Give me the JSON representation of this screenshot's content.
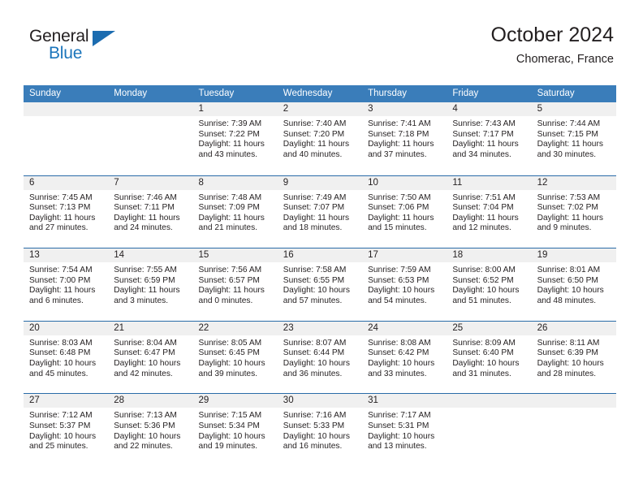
{
  "logo": {
    "word_top": "General",
    "word_bottom": "Blue",
    "triangle_icon": "triangle-icon"
  },
  "header": {
    "title": "October 2024",
    "subtitle": "Chomerac, France"
  },
  "colors": {
    "header_blue": "#3a7dba",
    "rule_blue": "#2a6ca8",
    "daynum_band": "#f0f0f0",
    "logo_blue": "#1b75bb",
    "text": "#231f20"
  },
  "weekdays": [
    "Sunday",
    "Monday",
    "Tuesday",
    "Wednesday",
    "Thursday",
    "Friday",
    "Saturday"
  ],
  "weeks": [
    [
      {
        "day": "",
        "sunrise": "",
        "sunset": "",
        "daylight1": "",
        "daylight2": "",
        "blank": true
      },
      {
        "day": "",
        "sunrise": "",
        "sunset": "",
        "daylight1": "",
        "daylight2": "",
        "blank": true
      },
      {
        "day": "1",
        "sunrise": "Sunrise: 7:39 AM",
        "sunset": "Sunset: 7:22 PM",
        "daylight1": "Daylight: 11 hours",
        "daylight2": "and 43 minutes."
      },
      {
        "day": "2",
        "sunrise": "Sunrise: 7:40 AM",
        "sunset": "Sunset: 7:20 PM",
        "daylight1": "Daylight: 11 hours",
        "daylight2": "and 40 minutes."
      },
      {
        "day": "3",
        "sunrise": "Sunrise: 7:41 AM",
        "sunset": "Sunset: 7:18 PM",
        "daylight1": "Daylight: 11 hours",
        "daylight2": "and 37 minutes."
      },
      {
        "day": "4",
        "sunrise": "Sunrise: 7:43 AM",
        "sunset": "Sunset: 7:17 PM",
        "daylight1": "Daylight: 11 hours",
        "daylight2": "and 34 minutes."
      },
      {
        "day": "5",
        "sunrise": "Sunrise: 7:44 AM",
        "sunset": "Sunset: 7:15 PM",
        "daylight1": "Daylight: 11 hours",
        "daylight2": "and 30 minutes."
      }
    ],
    [
      {
        "day": "6",
        "sunrise": "Sunrise: 7:45 AM",
        "sunset": "Sunset: 7:13 PM",
        "daylight1": "Daylight: 11 hours",
        "daylight2": "and 27 minutes."
      },
      {
        "day": "7",
        "sunrise": "Sunrise: 7:46 AM",
        "sunset": "Sunset: 7:11 PM",
        "daylight1": "Daylight: 11 hours",
        "daylight2": "and 24 minutes."
      },
      {
        "day": "8",
        "sunrise": "Sunrise: 7:48 AM",
        "sunset": "Sunset: 7:09 PM",
        "daylight1": "Daylight: 11 hours",
        "daylight2": "and 21 minutes."
      },
      {
        "day": "9",
        "sunrise": "Sunrise: 7:49 AM",
        "sunset": "Sunset: 7:07 PM",
        "daylight1": "Daylight: 11 hours",
        "daylight2": "and 18 minutes."
      },
      {
        "day": "10",
        "sunrise": "Sunrise: 7:50 AM",
        "sunset": "Sunset: 7:06 PM",
        "daylight1": "Daylight: 11 hours",
        "daylight2": "and 15 minutes."
      },
      {
        "day": "11",
        "sunrise": "Sunrise: 7:51 AM",
        "sunset": "Sunset: 7:04 PM",
        "daylight1": "Daylight: 11 hours",
        "daylight2": "and 12 minutes."
      },
      {
        "day": "12",
        "sunrise": "Sunrise: 7:53 AM",
        "sunset": "Sunset: 7:02 PM",
        "daylight1": "Daylight: 11 hours",
        "daylight2": "and 9 minutes."
      }
    ],
    [
      {
        "day": "13",
        "sunrise": "Sunrise: 7:54 AM",
        "sunset": "Sunset: 7:00 PM",
        "daylight1": "Daylight: 11 hours",
        "daylight2": "and 6 minutes."
      },
      {
        "day": "14",
        "sunrise": "Sunrise: 7:55 AM",
        "sunset": "Sunset: 6:59 PM",
        "daylight1": "Daylight: 11 hours",
        "daylight2": "and 3 minutes."
      },
      {
        "day": "15",
        "sunrise": "Sunrise: 7:56 AM",
        "sunset": "Sunset: 6:57 PM",
        "daylight1": "Daylight: 11 hours",
        "daylight2": "and 0 minutes."
      },
      {
        "day": "16",
        "sunrise": "Sunrise: 7:58 AM",
        "sunset": "Sunset: 6:55 PM",
        "daylight1": "Daylight: 10 hours",
        "daylight2": "and 57 minutes."
      },
      {
        "day": "17",
        "sunrise": "Sunrise: 7:59 AM",
        "sunset": "Sunset: 6:53 PM",
        "daylight1": "Daylight: 10 hours",
        "daylight2": "and 54 minutes."
      },
      {
        "day": "18",
        "sunrise": "Sunrise: 8:00 AM",
        "sunset": "Sunset: 6:52 PM",
        "daylight1": "Daylight: 10 hours",
        "daylight2": "and 51 minutes."
      },
      {
        "day": "19",
        "sunrise": "Sunrise: 8:01 AM",
        "sunset": "Sunset: 6:50 PM",
        "daylight1": "Daylight: 10 hours",
        "daylight2": "and 48 minutes."
      }
    ],
    [
      {
        "day": "20",
        "sunrise": "Sunrise: 8:03 AM",
        "sunset": "Sunset: 6:48 PM",
        "daylight1": "Daylight: 10 hours",
        "daylight2": "and 45 minutes."
      },
      {
        "day": "21",
        "sunrise": "Sunrise: 8:04 AM",
        "sunset": "Sunset: 6:47 PM",
        "daylight1": "Daylight: 10 hours",
        "daylight2": "and 42 minutes."
      },
      {
        "day": "22",
        "sunrise": "Sunrise: 8:05 AM",
        "sunset": "Sunset: 6:45 PM",
        "daylight1": "Daylight: 10 hours",
        "daylight2": "and 39 minutes."
      },
      {
        "day": "23",
        "sunrise": "Sunrise: 8:07 AM",
        "sunset": "Sunset: 6:44 PM",
        "daylight1": "Daylight: 10 hours",
        "daylight2": "and 36 minutes."
      },
      {
        "day": "24",
        "sunrise": "Sunrise: 8:08 AM",
        "sunset": "Sunset: 6:42 PM",
        "daylight1": "Daylight: 10 hours",
        "daylight2": "and 33 minutes."
      },
      {
        "day": "25",
        "sunrise": "Sunrise: 8:09 AM",
        "sunset": "Sunset: 6:40 PM",
        "daylight1": "Daylight: 10 hours",
        "daylight2": "and 31 minutes."
      },
      {
        "day": "26",
        "sunrise": "Sunrise: 8:11 AM",
        "sunset": "Sunset: 6:39 PM",
        "daylight1": "Daylight: 10 hours",
        "daylight2": "and 28 minutes."
      }
    ],
    [
      {
        "day": "27",
        "sunrise": "Sunrise: 7:12 AM",
        "sunset": "Sunset: 5:37 PM",
        "daylight1": "Daylight: 10 hours",
        "daylight2": "and 25 minutes."
      },
      {
        "day": "28",
        "sunrise": "Sunrise: 7:13 AM",
        "sunset": "Sunset: 5:36 PM",
        "daylight1": "Daylight: 10 hours",
        "daylight2": "and 22 minutes."
      },
      {
        "day": "29",
        "sunrise": "Sunrise: 7:15 AM",
        "sunset": "Sunset: 5:34 PM",
        "daylight1": "Daylight: 10 hours",
        "daylight2": "and 19 minutes."
      },
      {
        "day": "30",
        "sunrise": "Sunrise: 7:16 AM",
        "sunset": "Sunset: 5:33 PM",
        "daylight1": "Daylight: 10 hours",
        "daylight2": "and 16 minutes."
      },
      {
        "day": "31",
        "sunrise": "Sunrise: 7:17 AM",
        "sunset": "Sunset: 5:31 PM",
        "daylight1": "Daylight: 10 hours",
        "daylight2": "and 13 minutes."
      },
      {
        "day": "",
        "sunrise": "",
        "sunset": "",
        "daylight1": "",
        "daylight2": "",
        "blank": true
      },
      {
        "day": "",
        "sunrise": "",
        "sunset": "",
        "daylight1": "",
        "daylight2": "",
        "blank": true
      }
    ]
  ]
}
